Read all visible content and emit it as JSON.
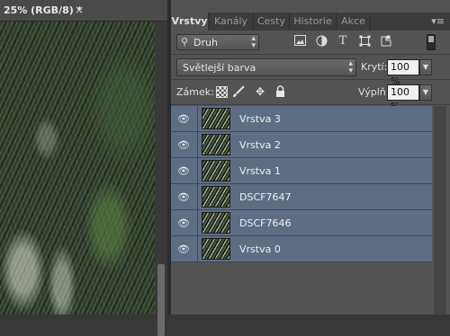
{
  "document": {
    "tab_title": "25% (RGB/8) *",
    "close_glyph": "×"
  },
  "panel": {
    "tabs": [
      "Vrstvy",
      "Kanály",
      "Cesty",
      "Historie",
      "Akce"
    ],
    "active_tab": "Vrstvy",
    "menu_glyph": "▾≡",
    "filter": {
      "kind_label": "Druh",
      "icons": [
        "image-filter-icon",
        "adjustment-filter-icon",
        "type-filter-icon",
        "shape-filter-icon",
        "smart-object-filter-icon"
      ]
    },
    "blend_mode": "Světlejší barva",
    "opacity_label": "Krytí:",
    "opacity_value": "100 %",
    "lock_label": "Zámek:",
    "fill_label": "Výplň:",
    "fill_value": "100 %",
    "layers": [
      {
        "name": "Vrstva 3",
        "visible": true
      },
      {
        "name": "Vrstva 2",
        "visible": true
      },
      {
        "name": "Vrstva 1",
        "visible": true
      },
      {
        "name": "DSCF7647",
        "visible": true
      },
      {
        "name": "DSCF7646",
        "visible": true
      },
      {
        "name": "Vrstva 0",
        "visible": true
      }
    ]
  },
  "colors": {
    "panel_bg": "#535353",
    "selected_layer_bg": "#5d6e84",
    "tab_bar_bg": "#3c3c3c"
  }
}
